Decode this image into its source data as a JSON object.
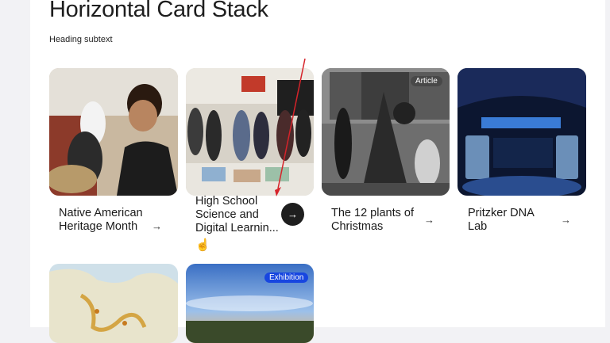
{
  "page": {
    "heading": "Horizontal Card Stack",
    "subtext": "Heading subtext"
  },
  "cards": [
    {
      "title": "Native American Heritage Month",
      "arrow": "→"
    },
    {
      "title": "High School Science and Digital Learnin...",
      "arrow": "→"
    },
    {
      "title": "The 12 plants of Christmas",
      "arrow": "→",
      "badge": "Article"
    },
    {
      "title": "Pritzker DNA Lab",
      "arrow": "→"
    },
    {
      "title": "",
      "arrow": ""
    },
    {
      "title": "",
      "arrow": "",
      "badge": "Exhibition"
    }
  ],
  "colors": {
    "accent": "#1746e0",
    "annotation": "#d6232a"
  },
  "icons": {
    "cursor": "hand-pointer-icon",
    "arrow": "arrow-right-icon"
  }
}
